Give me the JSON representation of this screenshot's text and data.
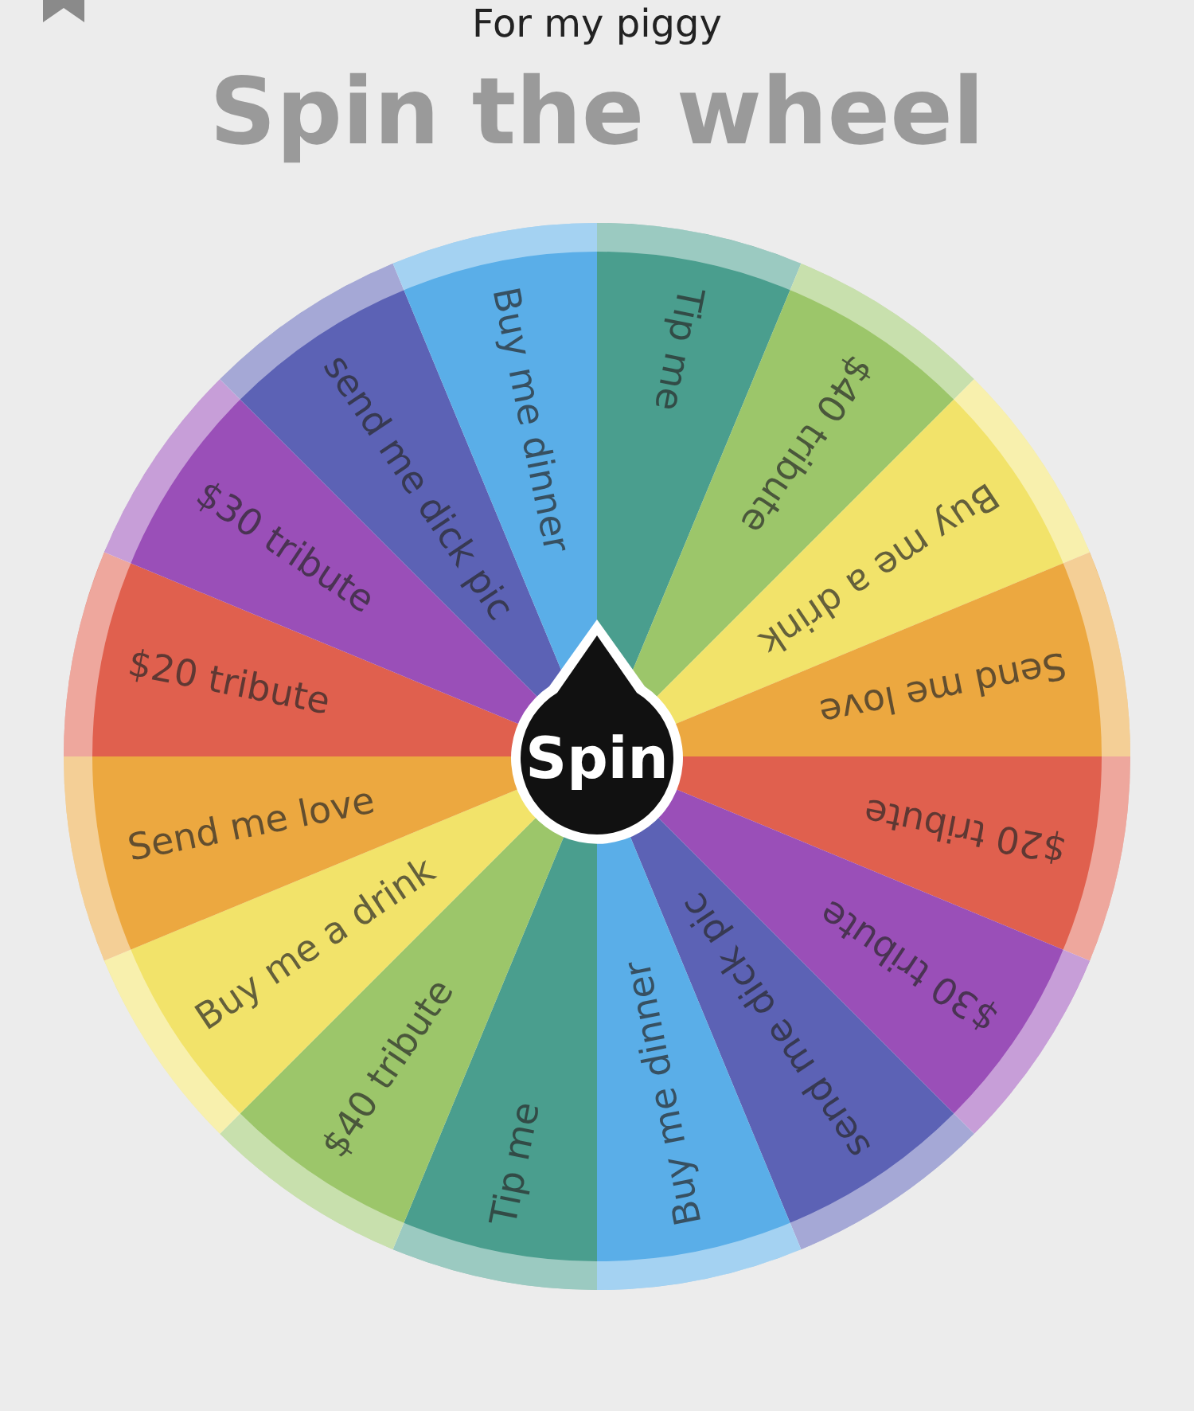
{
  "header": {
    "title": "For my piggy"
  },
  "heading": "Spin the wheel",
  "wheel": {
    "segments": [
      {
        "label": "Tip me",
        "color": "#4a9e8e"
      },
      {
        "label": "$40 tribute",
        "color": "#9cc66a"
      },
      {
        "label": "Buy me a drink",
        "color": "#f2e36a"
      },
      {
        "label": "Send me love",
        "color": "#eca840"
      },
      {
        "label": "$20 tribute",
        "color": "#e0604e"
      },
      {
        "label": "$30 tribute",
        "color": "#9a4fb8"
      },
      {
        "label": "send me dick pic",
        "color": "#5c62b5"
      },
      {
        "label": "Buy me dinner",
        "color": "#5aaee8"
      },
      {
        "label": "Tip me",
        "color": "#4a9e8e"
      },
      {
        "label": "$40 tribute",
        "color": "#9cc66a"
      },
      {
        "label": "Buy me a drink",
        "color": "#f2e36a"
      },
      {
        "label": "Send me love",
        "color": "#eca840"
      },
      {
        "label": "$20 tribute",
        "color": "#e0604e"
      },
      {
        "label": "$30 tribute",
        "color": "#9a4fb8"
      },
      {
        "label": "send me dick pic",
        "color": "#5c62b5"
      },
      {
        "label": "Buy me dinner",
        "color": "#5aaee8"
      }
    ],
    "spin_button": "Spin"
  }
}
